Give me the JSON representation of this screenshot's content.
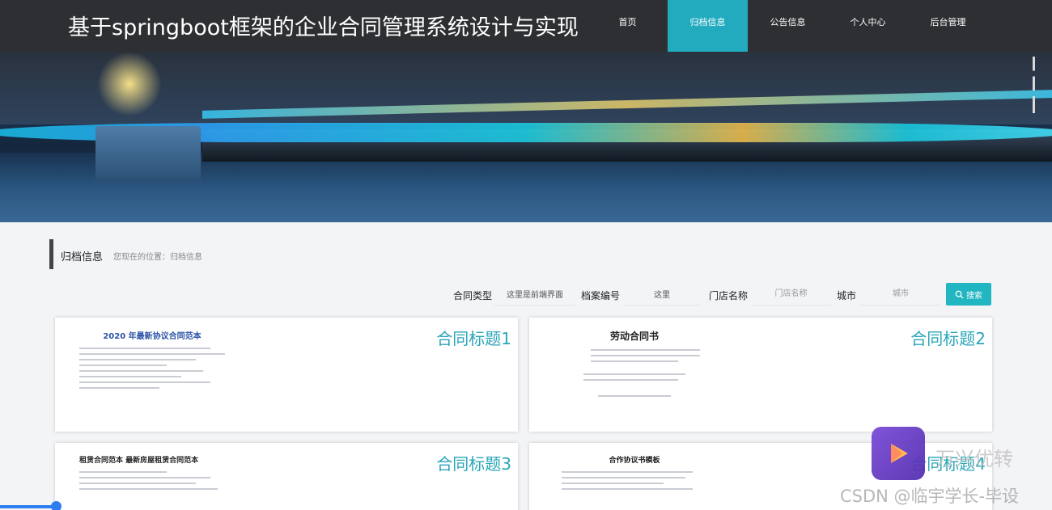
{
  "header": {
    "title": "基于springboot框架的企业合同管理系统设计与实现",
    "nav": [
      {
        "label": "首页",
        "active": false
      },
      {
        "label": "归档信息",
        "active": true
      },
      {
        "label": "公告信息",
        "active": false
      },
      {
        "label": "个人中心",
        "active": false
      },
      {
        "label": "后台管理",
        "active": false
      }
    ]
  },
  "section": {
    "title": "归档信息",
    "breadcrumb": "您现在的位置：归档信息"
  },
  "search": {
    "contract_type_label": "合同类型",
    "contract_type_value": "这里是前端界面",
    "archive_no_label": "档案编号",
    "archive_no_value": "这里",
    "store_label": "门店名称",
    "store_placeholder": "门店名称",
    "city_label": "城市",
    "city_placeholder": "城市",
    "button_label": "搜索"
  },
  "cards": [
    {
      "title": "合同标题1",
      "doc_heading": "2020 年最新协议合同范本"
    },
    {
      "title": "合同标题2",
      "doc_heading": "劳动合同书"
    },
    {
      "title": "合同标题3",
      "doc_heading": "租赁合同范本  最新房屋租赁合同范本"
    },
    {
      "title": "合同标题4",
      "doc_heading": "合作协议书模板"
    }
  ],
  "watermark": {
    "brand": "万兴优转",
    "csdn": "CSDN @临宇学长-毕设"
  },
  "colors": {
    "accent": "#22abbe",
    "header_bg": "#2d2f33"
  }
}
